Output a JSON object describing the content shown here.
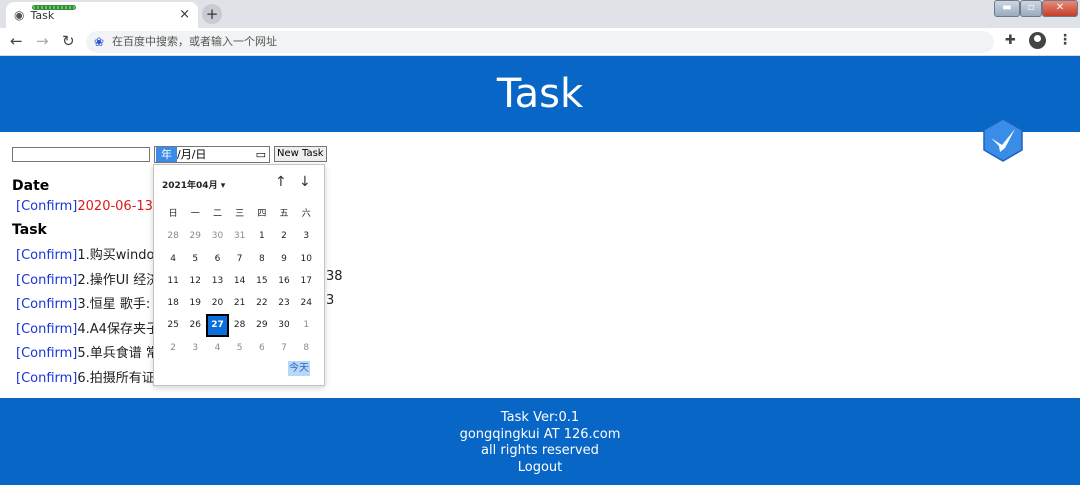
{
  "browser": {
    "tab_title": "Task",
    "tab_close": "×",
    "new_tab": "+",
    "address_placeholder": "在百度中搜索，或者输入一个网址"
  },
  "header": {
    "title": "Task"
  },
  "form": {
    "task_value": "",
    "date_year": "年",
    "date_rest": "/月/日",
    "new_task_label": "New Task"
  },
  "date_section": {
    "heading": "Date",
    "item": {
      "confirm": "[Confirm]",
      "text": "2020-06-13: !"
    }
  },
  "task_section": {
    "heading": "Task",
    "items": [
      {
        "confirm": "[Confirm]",
        "text": "1.购买window"
      },
      {
        "confirm": "[Confirm]",
        "text": "2.操作UI 经济",
        "tail": "38"
      },
      {
        "confirm": "[Confirm]",
        "text": "3.恒星 歌手: 汪",
        "tail": "3"
      },
      {
        "confirm": "[Confirm]",
        "text": "4.A4保存夹子"
      },
      {
        "confirm": "[Confirm]",
        "text": "5.单兵食谱 常"
      },
      {
        "confirm": "[Confirm]",
        "text": "6.拍摄所有证件"
      }
    ]
  },
  "date_picker": {
    "month_label": "2021年04月 ▾",
    "up": "↑",
    "down": "↓",
    "weekdays": [
      "日",
      "一",
      "二",
      "三",
      "四",
      "五",
      "六"
    ],
    "weeks": [
      [
        "28",
        "29",
        "30",
        "31",
        "1",
        "2",
        "3"
      ],
      [
        "4",
        "5",
        "6",
        "7",
        "8",
        "9",
        "10"
      ],
      [
        "11",
        "12",
        "13",
        "14",
        "15",
        "16",
        "17"
      ],
      [
        "18",
        "19",
        "20",
        "21",
        "22",
        "23",
        "24"
      ],
      [
        "25",
        "26",
        "27",
        "28",
        "29",
        "30",
        "1"
      ],
      [
        "2",
        "3",
        "4",
        "5",
        "6",
        "7",
        "8"
      ]
    ],
    "selected_day": "27",
    "today_label": "今天"
  },
  "footer": {
    "lines": [
      "Task Ver:0.1",
      "gongqingkui AT 126.com",
      "all rights reserved",
      "Logout"
    ]
  },
  "colors": {
    "brand_blue": "#0866c6",
    "link_blue": "#1a35d6",
    "alert_red": "#e01818",
    "selected_day": "#0a6fdc"
  }
}
